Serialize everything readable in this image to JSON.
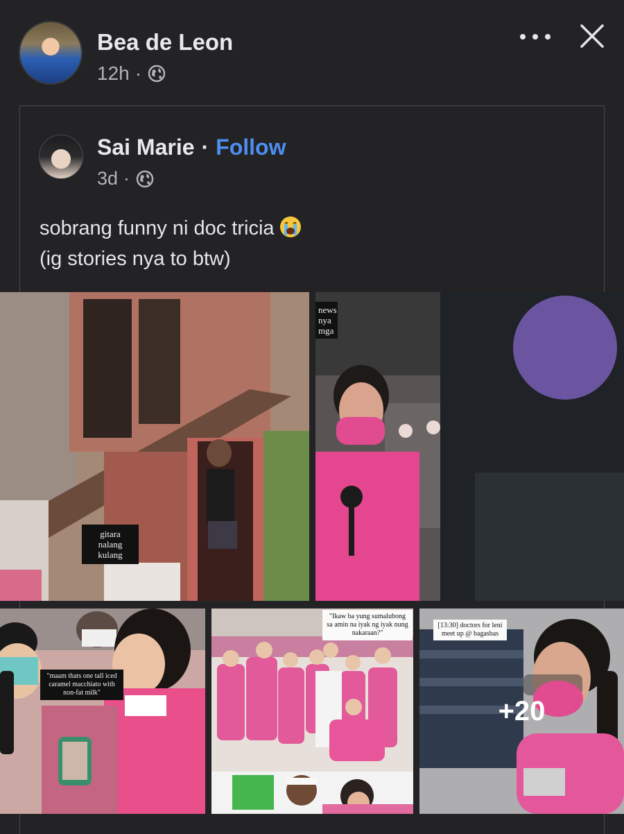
{
  "post": {
    "author": "Bea de Leon",
    "time": "12h",
    "separator": "·"
  },
  "shared": {
    "author": "Sai Marie",
    "separator": "·",
    "follow_label": "Follow",
    "time": "3d",
    "text_line1": "sobrang funny ni doc tricia",
    "text_line2": "(ig stories nya to btw)",
    "emoji": "crying-face"
  },
  "photos": {
    "p1_caption": "gitara nalang kulang",
    "p2_caption": "news\nnya\nmga",
    "p3_caption": "\"maam thats one tall iced caramel macchiato with non-fat milk\"",
    "p4_caption": "\"Ikaw ba yung sumalubong sa amin na iyak ng iyak nung nakaraan?\"",
    "p5_caption": "[13:30] doctors for leni meet up @ bagasbas",
    "more_count": "+20"
  },
  "colors": {
    "background": "#232326",
    "link": "#4d8ff0",
    "text": "#e4e6eb",
    "muted": "#b0b3b8"
  },
  "icons": [
    "globe-icon",
    "more-icon",
    "close-icon"
  ]
}
